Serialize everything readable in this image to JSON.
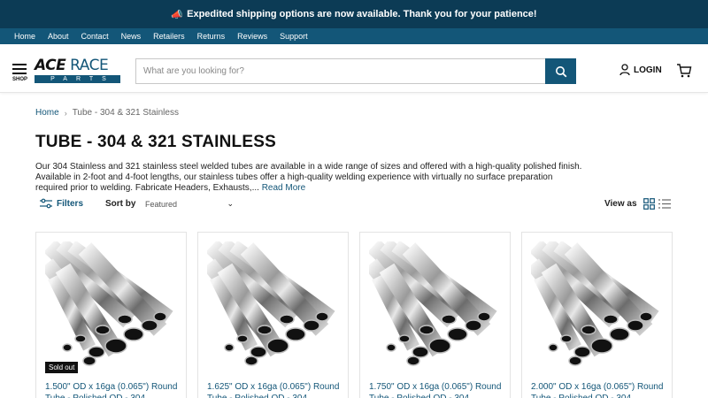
{
  "announcement": {
    "icon": "megaphone-icon",
    "text": "Expedited shipping options are now available. Thank you for your patience!"
  },
  "utility_nav": [
    "Home",
    "About",
    "Contact",
    "News",
    "Retailers",
    "Returns",
    "Reviews",
    "Support"
  ],
  "header": {
    "menu_label": "SHOP",
    "logo": {
      "top": "ACE RACE",
      "bottom": "PARTS"
    },
    "search_placeholder": "What are you looking for?",
    "login_label": "LOGIN"
  },
  "breadcrumb": {
    "home": "Home",
    "current": "Tube - 304 & 321 Stainless"
  },
  "page_title": "TUBE - 304 & 321 STAINLESS",
  "description": {
    "text": "Our 304 Stainless and 321 stainless steel welded tubes are available in a wide range of sizes and offered with a high-quality polished finish. Available in 2-foot and 4-foot lengths, our stainless tubes offer a high-quality welding experience with virtually no surface preparation required prior to welding. Fabricate Headers, Exhausts,...",
    "read_more": "Read More"
  },
  "toolbar": {
    "filters_label": "Filters",
    "sort_label": "Sort by",
    "sort_value": "Featured",
    "view_label": "View as"
  },
  "products": [
    {
      "name": "1.500\" OD x 16ga (0.065\") Round Tube - Polished OD - 304",
      "badge": "Sold out"
    },
    {
      "name": "1.625\" OD x 16ga (0.065\") Round Tube - Polished OD - 304",
      "badge": ""
    },
    {
      "name": "1.750\" OD x 16ga (0.065\") Round Tube - Polished OD - 304",
      "badge": ""
    },
    {
      "name": "2.000\" OD x 16ga (0.065\") Round Tube - Polished OD - 304",
      "badge": ""
    }
  ],
  "colors": {
    "navy": "#0c3b55",
    "brand": "#135678"
  }
}
